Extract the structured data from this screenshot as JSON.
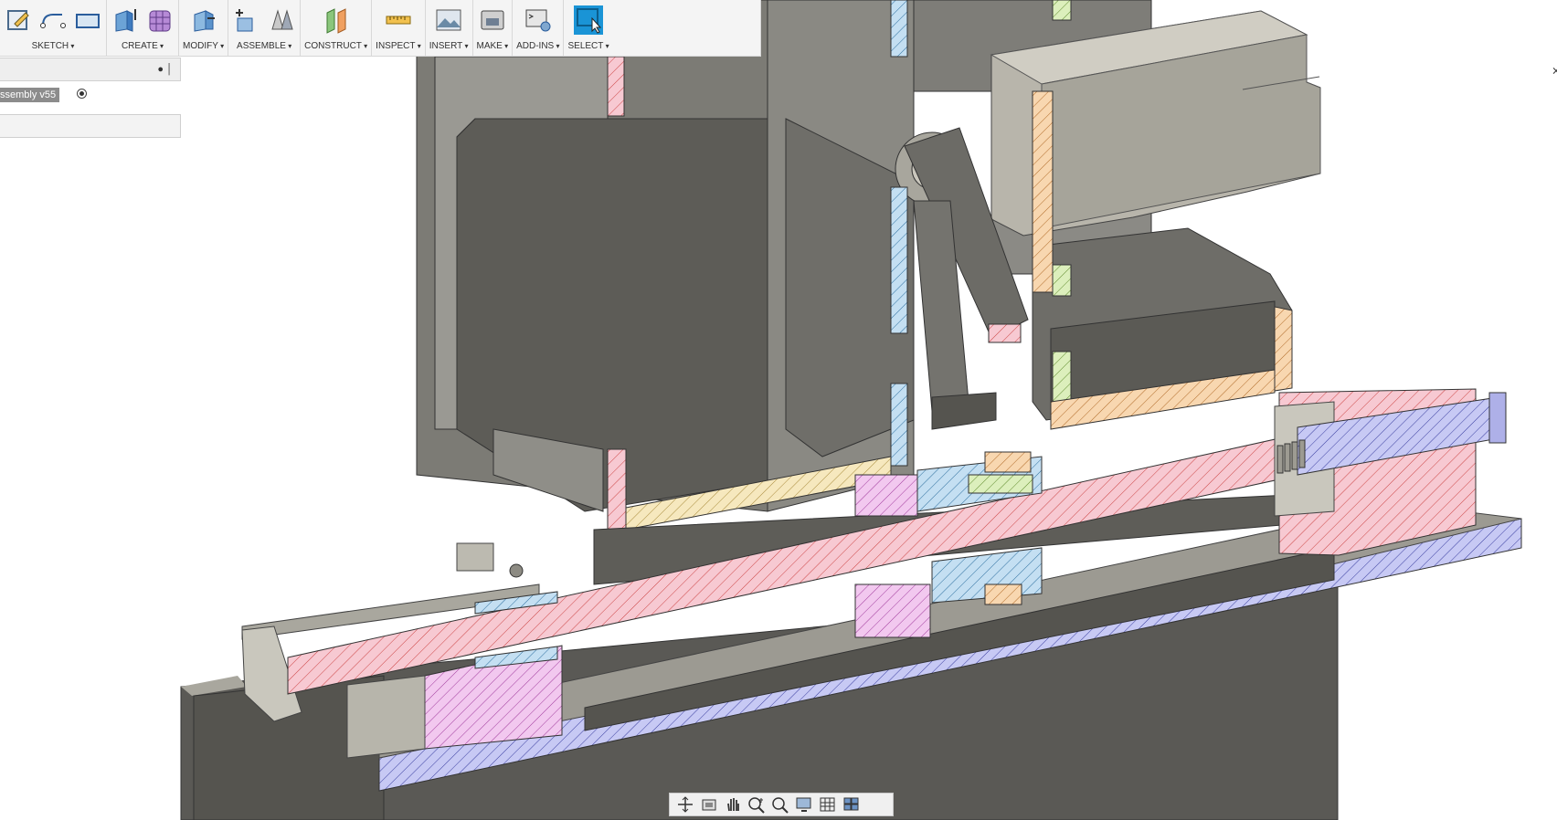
{
  "toolbar": {
    "groups": [
      {
        "label": "SKETCH"
      },
      {
        "label": "CREATE"
      },
      {
        "label": "MODIFY"
      },
      {
        "label": "ASSEMBLE"
      },
      {
        "label": "CONSTRUCT"
      },
      {
        "label": "INSPECT"
      },
      {
        "label": "INSERT"
      },
      {
        "label": "MAKE"
      },
      {
        "label": "ADD-INS"
      },
      {
        "label": "SELECT"
      }
    ]
  },
  "browser": {
    "assembly_name": "ssembly v55"
  },
  "colors": {
    "cut_pink": "#f6c6d0",
    "cut_blue": "#b9d9f0",
    "cut_lavender": "#c6c8f4",
    "cut_magenta": "#f0c4ee",
    "cut_orange": "#f7d2a8",
    "cut_yellow": "#f4e4b0",
    "cut_green": "#d6ecb0",
    "metal_dark": "#5f5e58",
    "metal_mid": "#8a8a84",
    "metal_light": "#c9c7bd",
    "select_active": "#1a94d6"
  },
  "navbar": {
    "icons": [
      "orbit-icon",
      "look-at-icon",
      "pan-icon",
      "zoom-icon",
      "zoom-window-icon",
      "display-settings-icon",
      "grid-icon",
      "viewports-icon"
    ]
  }
}
